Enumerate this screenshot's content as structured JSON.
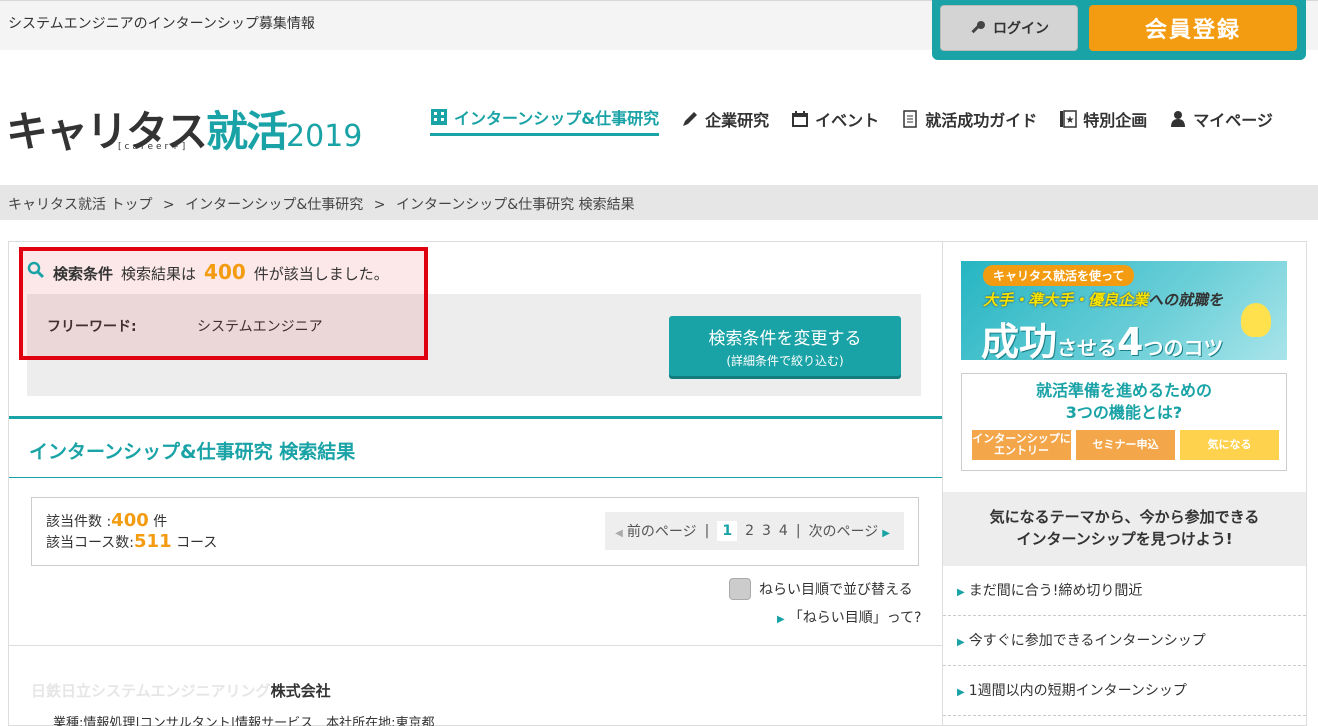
{
  "topbar": {
    "tagline": "システムエンジニアのインターンシップ募集情報",
    "login_label": "ログイン",
    "register_label": "会員登録"
  },
  "logo": {
    "text_main": "キャリタス",
    "text_accent": "就活",
    "year": "2019",
    "sub": "[career+]"
  },
  "nav": {
    "items": [
      {
        "label": "インターンシップ&仕事研究",
        "icon": "building-icon"
      },
      {
        "label": "企業研究",
        "icon": "pencil-icon"
      },
      {
        "label": "イベント",
        "icon": "calendar-icon"
      },
      {
        "label": "就活成功ガイド",
        "icon": "document-icon"
      },
      {
        "label": "特別企画",
        "icon": "star-book-icon"
      },
      {
        "label": "マイページ",
        "icon": "person-icon"
      }
    ]
  },
  "breadcrumb": {
    "items": [
      "キャリタス就活 トップ",
      ">",
      "インターンシップ&仕事研究",
      ">",
      "インターンシップ&仕事研究 検索結果"
    ]
  },
  "search": {
    "condition_label": "検索条件",
    "result_prefix": "検索結果は",
    "result_count": "400",
    "result_suffix": "件が該当しました。",
    "freeword_label": "フリーワード:",
    "freeword_value": "システムエンジニア",
    "change_btn_line1": "検索条件を変更する",
    "change_btn_line2": "(詳細条件で絞り込む)"
  },
  "results": {
    "title": "インターンシップ&仕事研究 検索結果",
    "hits_label": "該当件数   :",
    "hits_value": "400",
    "hits_unit": "件",
    "courses_label": "該当コース数:",
    "courses_value": "511",
    "courses_unit": "コース",
    "pager": {
      "prev": "前のページ",
      "sep": "|",
      "pages": [
        "1",
        "2",
        "3",
        "4"
      ],
      "current": "1",
      "next": "次のページ"
    },
    "sort_label": "ねらい目順で並び替える",
    "sort_help": "「ねらい目順」って?",
    "company_faded": "日鉄日立システムエンジニアリング",
    "company_name": "株式会社",
    "company_meta": "業種:情報処理|コンサルタント|情報サービス　本社所在地:東京都"
  },
  "sidebar": {
    "banner1": {
      "pill": "キャリタス就活を使って",
      "line2_hl": "大手・準大手・優良企業",
      "line2_rest": "への就職を",
      "big1": "成功",
      "mid1": "させる",
      "big2": "4",
      "mid2": "つのコツ"
    },
    "banner2": {
      "title_line1": "就活準備を進めるための",
      "title_line2": "3つの機能とは?",
      "btn1": "インターンシップにエントリー",
      "btn2": "セミナー申込",
      "btn3": "気になる"
    },
    "theme_head_line1": "気になるテーマから、今から参加できる",
    "theme_head_line2": "インターンシップを見つけよう!",
    "themes": [
      "まだ間に合う!締め切り間近",
      "今すぐに参加できるインターンシップ",
      "1週間以内の短期インターンシップ"
    ]
  },
  "colors": {
    "accent": "#1aa3a6",
    "orange": "#f39c12",
    "highlight_border": "#e1000f"
  }
}
